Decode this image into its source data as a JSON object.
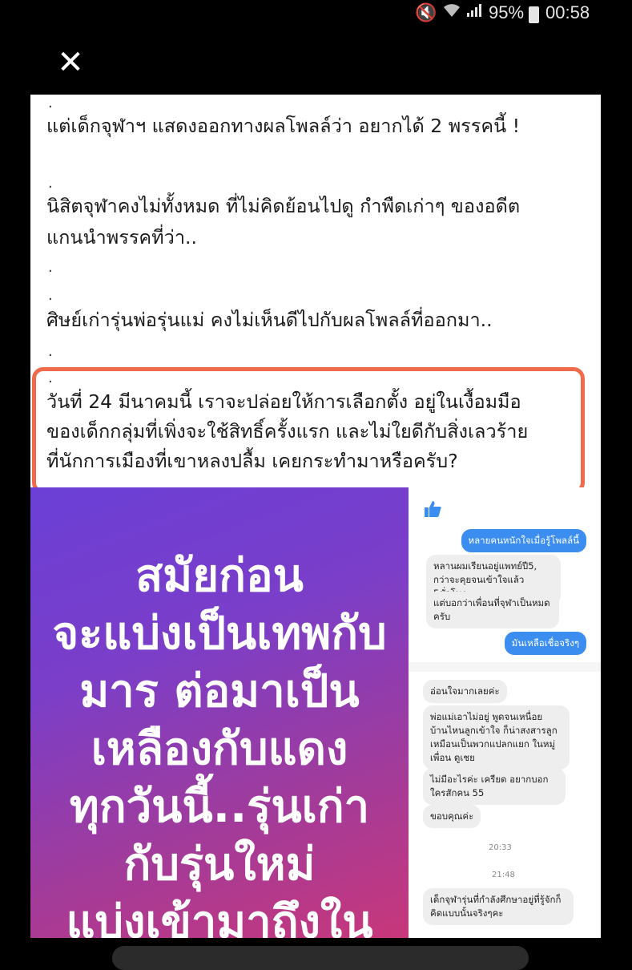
{
  "status_bar": {
    "mute_icon": "🔇",
    "wifi_icon": "wifi-icon",
    "signal_icon": "signal-icon",
    "battery": "95%",
    "time": "00:58"
  },
  "viewer": {
    "close_icon": "✕"
  },
  "post": {
    "lines": [
      "แต่เด็กจุฬาฯ แสดงออกทางผลโพลล์ว่า อยากได้ 2 พรรคนี้ !",
      "นิสิตจุฬาคงไม่ทั้งหมด ที่ไม่คิดย้อนไปดู กำพืดเก่าๆ ของอดีต",
      "แกนนำพรรคที่ว่า..",
      "ศิษย์เก่ารุ่นพ่อรุ่นแม่ คงไม่เห็นดีไปกับผลโพลล์ที่ออกมา..",
      "วันที่ 24 มีนาคมนี้ เราจะปล่อยให้การเลือกตั้ง อยู่ในเงื้อมมือ",
      "ของเด็กกลุ่มที่เพิ่งจะใช้สิทธิ์ครั้งแรก และไม่ใยดีกับสิ่งเลวร้าย",
      "ที่นักการเมืองที่เขาหลงปลื้ม เคยกระทำมาหรือครับ?"
    ],
    "dot": "."
  },
  "poster": {
    "lines": [
      "สมัยก่อน",
      "จะแบ่งเป็นเทพกับ",
      "มาร ต่อมาเป็น",
      "เหลืองกับแดง",
      "ทุกวันนี้..รุ่นเก่า",
      "กับรุ่นใหม่",
      "แบ่งเข้ามาถึงใน"
    ]
  },
  "chat": {
    "top_msgs": [
      {
        "dir": "out",
        "text": "หลายคนหนักใจเมื่อรู้โพลล์นี้"
      },
      {
        "dir": "in",
        "text": "หลานผมเรียนอยู่แพทย์ปี5, กว่าจะคุยจนเข้าใจแล้ว 5ชั่วโมง"
      },
      {
        "dir": "in",
        "text": "แต่บอกว่าเพื่อนที่จุฬาเป็นหมดครับ"
      },
      {
        "dir": "out",
        "text": "มันเหลือเชื่อจริงๆ"
      }
    ],
    "bottom_msgs": [
      {
        "dir": "in",
        "text": "อ่อนใจมากเลยค่ะ"
      },
      {
        "dir": "in",
        "text": "พ่อแม่เอาไม่อยู่ พูดจนเหนื่อย บ้านไหนลูกเข้าใจ ก็น่าสงสารลูก เหมือนเป็นพวกแปลกแยก ในหมู่เพื่อน ดูเชย"
      },
      {
        "dir": "in",
        "text": "ไม่มีอะไรค่ะ เครียด อยากบอกใครสักคน 55"
      },
      {
        "dir": "in",
        "text": "ขอบคุณค่ะ"
      },
      {
        "dir": "in",
        "text": "เด็กจุฬารุ่นที่กำลังศึกษาอยู่ที่รู้จักก็คิดแบบนั้นจริงๆคะ"
      }
    ],
    "times": [
      "20:33",
      "21:48"
    ]
  },
  "colors": {
    "highlight": "#ef6b4c",
    "chat_out": "#3b8ef0",
    "poster_top": "#6b3fd6",
    "poster_bottom": "#c8377a"
  }
}
